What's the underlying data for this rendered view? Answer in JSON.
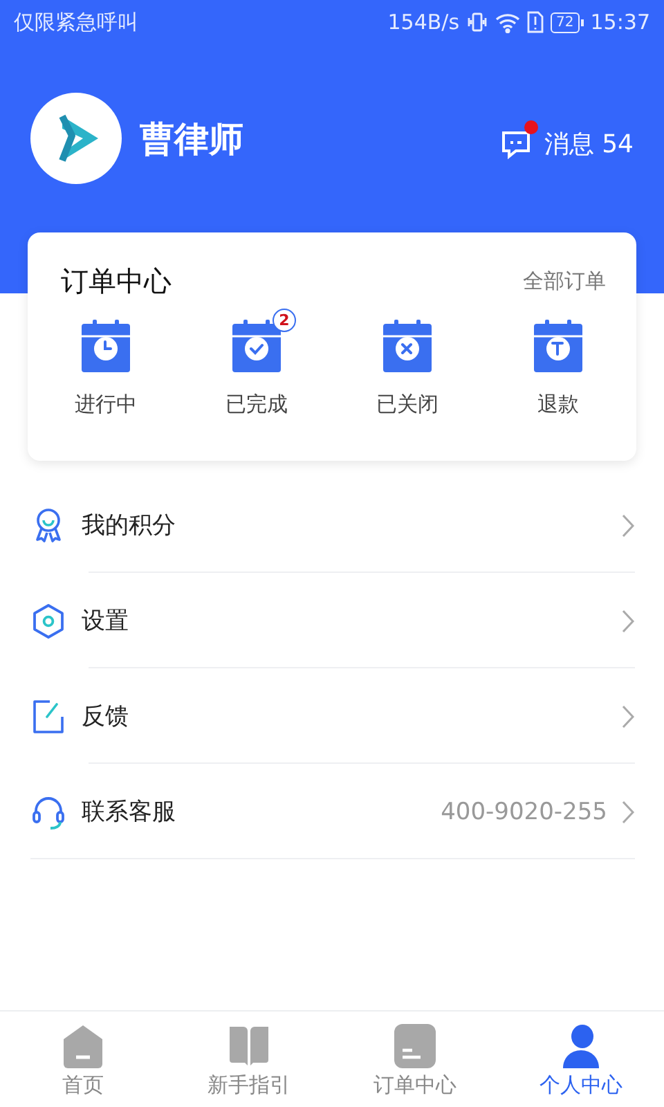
{
  "status_bar": {
    "carrier": "仅限紧急呼叫",
    "speed": "154B/s",
    "battery": "72",
    "time": "15:37"
  },
  "profile": {
    "name": "曹律师",
    "messages": {
      "label": "消息",
      "count": "54",
      "unread": true
    }
  },
  "orders": {
    "title": "订单中心",
    "all_link": "全部订单",
    "items": [
      {
        "kind": "clock",
        "label": "进行中"
      },
      {
        "kind": "check",
        "label": "已完成",
        "badge": "2"
      },
      {
        "kind": "cross",
        "label": "已关闭"
      },
      {
        "kind": "refund",
        "label": "退款"
      }
    ]
  },
  "menu": [
    {
      "kind": "points",
      "label": "我的积分"
    },
    {
      "kind": "settings",
      "label": "设置"
    },
    {
      "kind": "feedback",
      "label": "反馈"
    },
    {
      "kind": "support",
      "label": "联系客服",
      "value": "400-9020-255"
    }
  ],
  "tabs": [
    {
      "kind": "home",
      "label": "首页",
      "selected": false
    },
    {
      "kind": "guide",
      "label": "新手指引",
      "selected": false
    },
    {
      "kind": "orders",
      "label": "订单中心",
      "selected": false
    },
    {
      "kind": "profile",
      "label": "个人中心",
      "selected": true
    }
  ]
}
